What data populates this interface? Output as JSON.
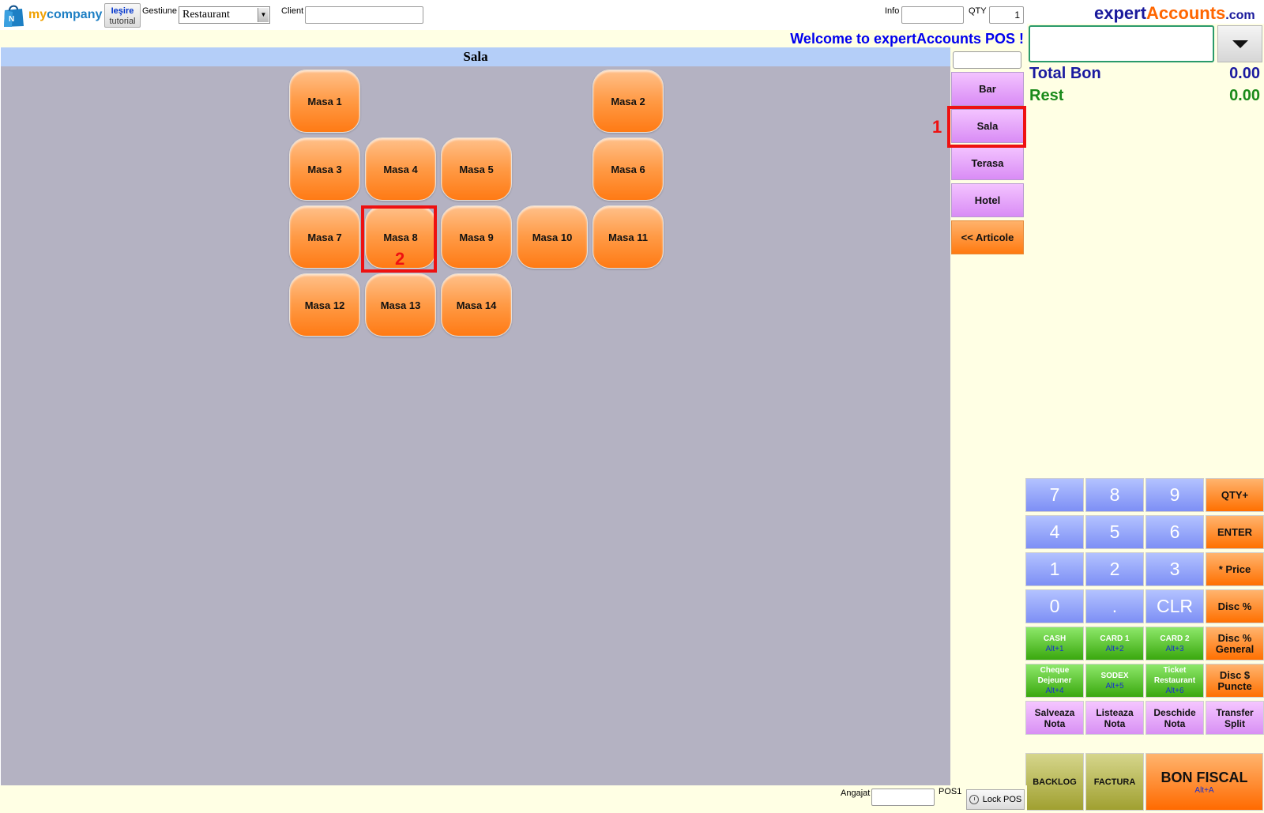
{
  "topbar": {
    "logo": {
      "my": "my",
      "company": "company"
    },
    "exit_button": {
      "line1": "Ieşire",
      "line2": "tutorial"
    },
    "gestiune_label": "Gestiune",
    "gestiune_value": "Restaurant",
    "client_label": "Client",
    "info_label": "Info",
    "qty_label": "QTY",
    "qty_value": "1"
  },
  "brand": {
    "part1": "expert",
    "part2": "Accounts",
    "part3": ".com"
  },
  "welcome": "Welcome to expertAccounts POS !",
  "room": {
    "title": "Sala",
    "tables": [
      "Masa 1",
      "Masa 2",
      "Masa 3",
      "Masa 4",
      "Masa 5",
      "Masa 6",
      "Masa 7",
      "Masa 8",
      "Masa 9",
      "Masa 10",
      "Masa 11",
      "Masa 12",
      "Masa 13",
      "Masa 14"
    ]
  },
  "zones": [
    "Bar",
    "Sala",
    "Terasa",
    "Hotel"
  ],
  "articole_button": "<< Articole",
  "totals": {
    "total_bon_label": "Total Bon",
    "total_bon_value": "0.00",
    "rest_label": "Rest",
    "rest_value": "0.00"
  },
  "keypad": {
    "digits": [
      "7",
      "8",
      "9",
      "4",
      "5",
      "6",
      "1",
      "2",
      "3",
      "0",
      ".",
      "CLR"
    ],
    "ops": [
      "QTY+",
      "ENTER",
      "* Price",
      "Disc %"
    ],
    "disc_general": [
      "Disc %",
      "General"
    ],
    "disc_puncte": [
      "Disc $",
      "Puncte"
    ],
    "payments": [
      {
        "label": [
          "CASH"
        ],
        "alt": "Alt+1"
      },
      {
        "label": [
          "CARD 1"
        ],
        "alt": "Alt+2"
      },
      {
        "label": [
          "CARD 2"
        ],
        "alt": "Alt+3"
      },
      {
        "label": [
          "Cheque",
          "Dejeuner"
        ],
        "alt": "Alt+4"
      },
      {
        "label": [
          "SODEX"
        ],
        "alt": "Alt+5"
      },
      {
        "label": [
          "Ticket",
          "Restaurant"
        ],
        "alt": "Alt+6"
      }
    ],
    "notes": [
      [
        "Salveaza",
        "Nota"
      ],
      [
        "Listeaza",
        "Nota"
      ],
      [
        "Deschide",
        "Nota"
      ],
      [
        "Transfer",
        "Split"
      ]
    ],
    "backlog": "BACKLOG",
    "factura": "FACTURA",
    "bon_fiscal": "BON FISCAL",
    "bon_fiscal_alt": "Alt+A"
  },
  "bottom": {
    "angajat_label": "Angajat",
    "pos_label": "POS1",
    "lock_label": "Lock POS"
  },
  "annotations": [
    "1",
    "2"
  ],
  "colors": {
    "table_orange": "#ff8a2a",
    "zone_pink": "#e6a6fa",
    "annotation_red": "#ee1111",
    "welcome_blue": "#0000ee"
  }
}
